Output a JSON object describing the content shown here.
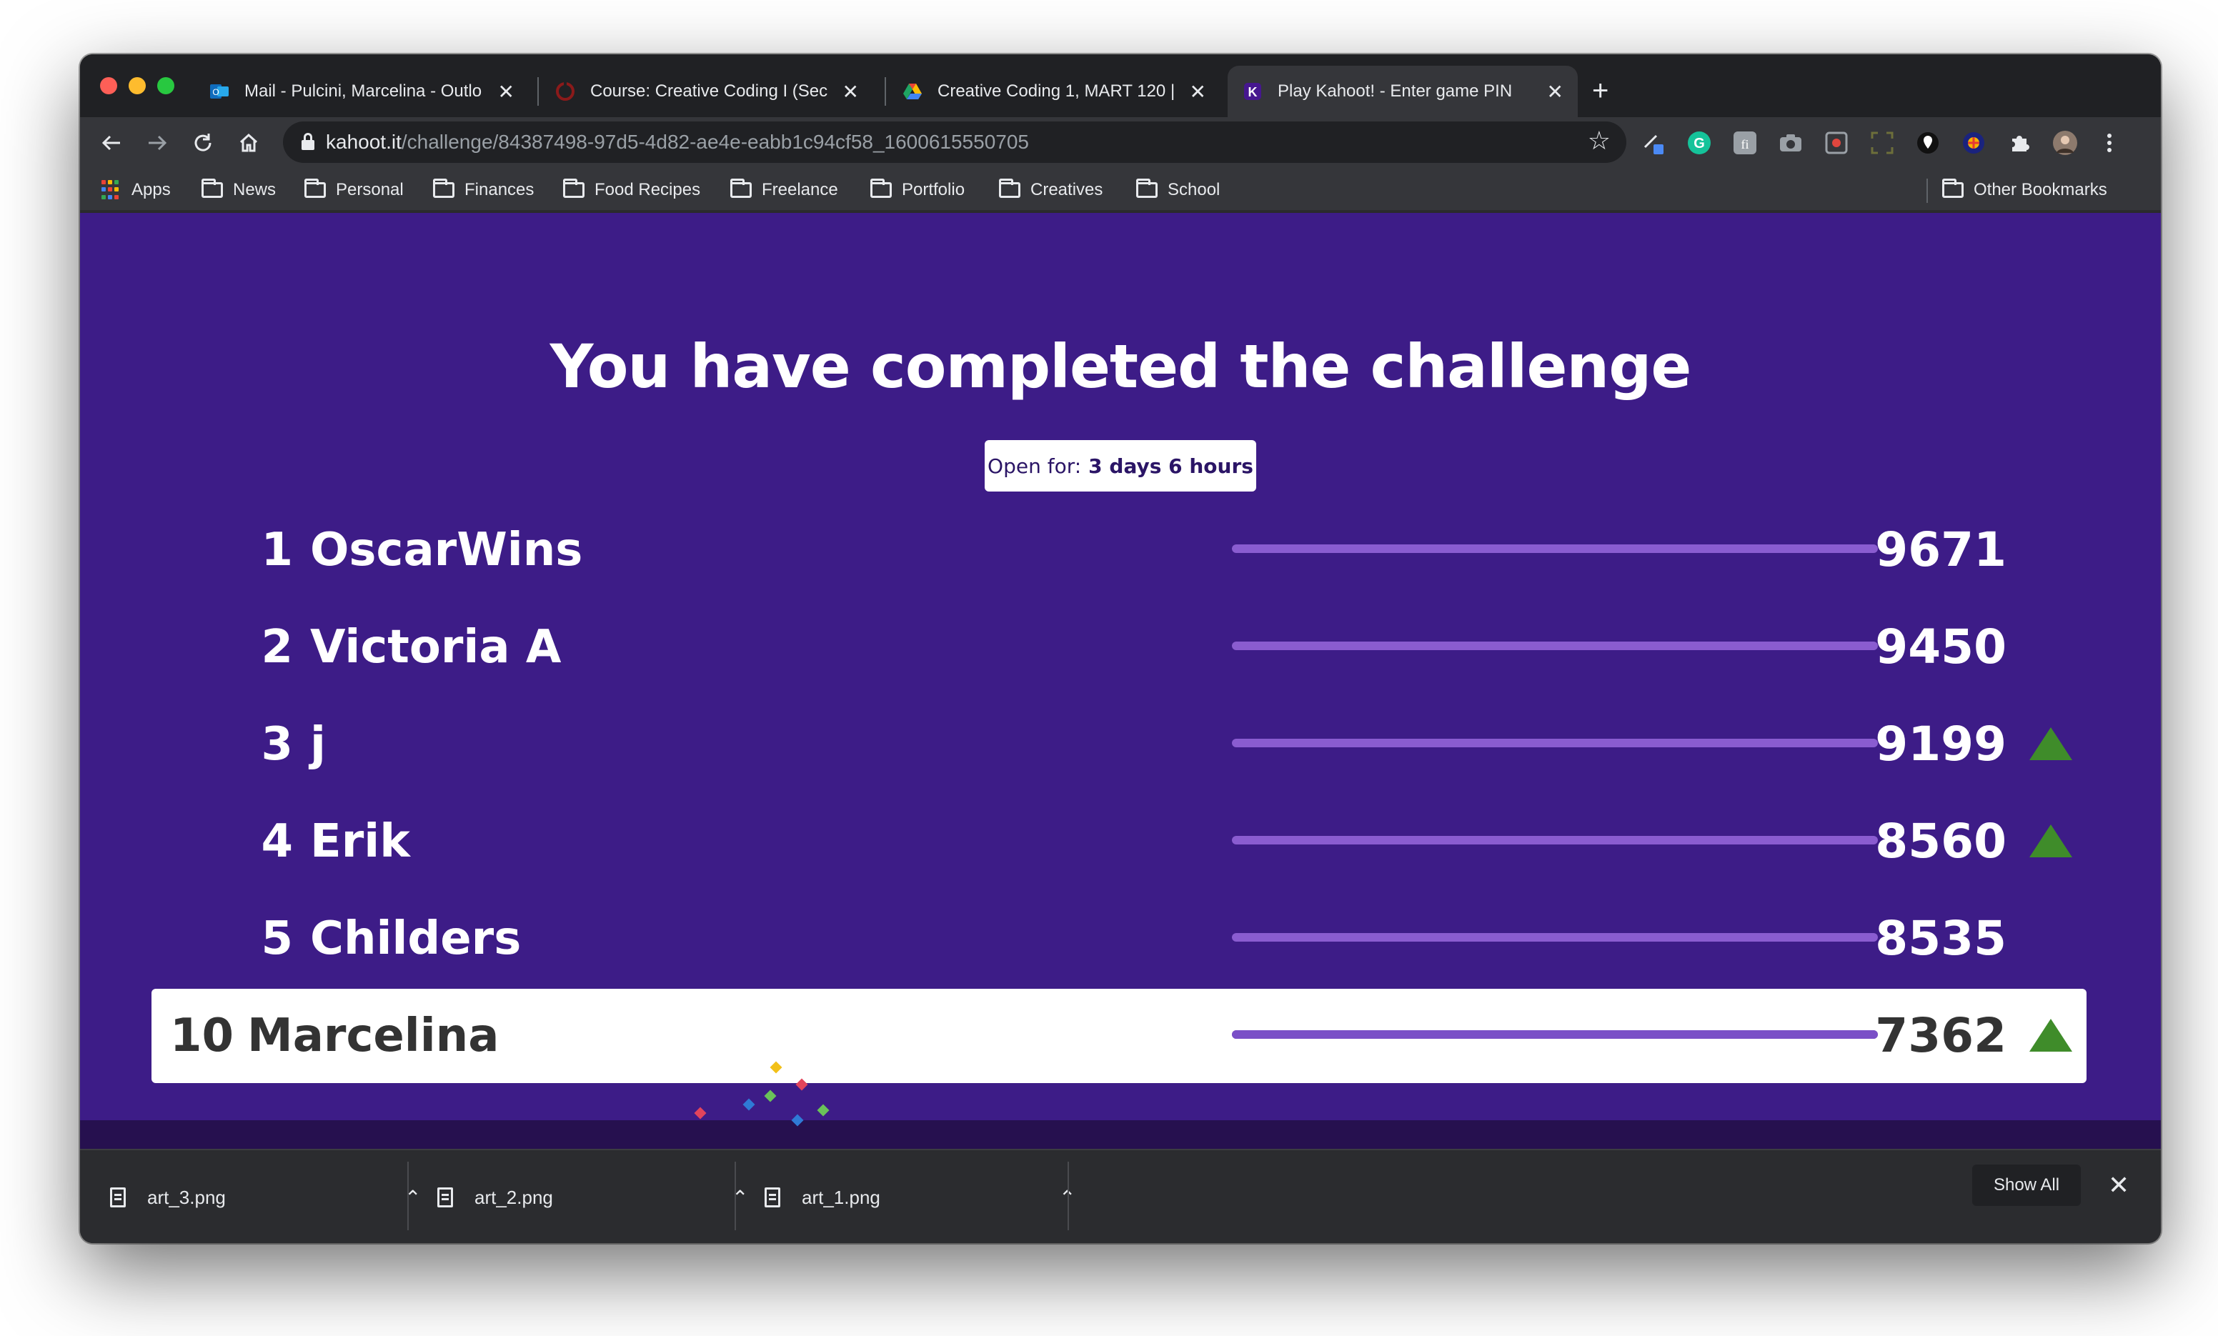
{
  "browser": {
    "tabs": [
      {
        "title": "Mail - Pulcini, Marcelina - Outlo",
        "icon": "outlook-icon",
        "active": false
      },
      {
        "title": "Course: Creative Coding I (Sec",
        "icon": "course-icon",
        "active": false
      },
      {
        "title": "Creative Coding 1, MART 120 |",
        "icon": "drive-icon",
        "active": false
      },
      {
        "title": "Play Kahoot! - Enter game PIN",
        "icon": "kahoot-icon",
        "active": true
      }
    ],
    "tab_close_glyph": "✕",
    "new_tab_glyph": "+",
    "url_host": "kahoot.it",
    "url_path": "/challenge/84387498-97d5-4d82-ae4e-eabb1c94cf58_1600615550705",
    "bookmarks": [
      "Apps",
      "News",
      "Personal",
      "Finances",
      "Food Recipes",
      "Freelance",
      "Portfolio",
      "Creatives",
      "School"
    ],
    "other_bookmarks": "Other Bookmarks"
  },
  "page": {
    "headline": "You have completed the challenge",
    "open_for_label": "Open for:",
    "open_for_value": "3 days 6 hours",
    "leaderboard": [
      {
        "rank": "1",
        "name": "OscarWins",
        "score": "9671",
        "trend_up": false
      },
      {
        "rank": "2",
        "name": "Victoria A",
        "score": "9450",
        "trend_up": false
      },
      {
        "rank": "3",
        "name": "j",
        "score": "9199",
        "trend_up": true
      },
      {
        "rank": "4",
        "name": "Erik",
        "score": "8560",
        "trend_up": true
      },
      {
        "rank": "5",
        "name": "Childers",
        "score": "8535",
        "trend_up": false
      }
    ],
    "me": {
      "rank": "10",
      "name": "Marcelina",
      "score": "7362",
      "trend_up": true
    },
    "bar_fill_fraction": 1.0,
    "colors": {
      "background": "#3d1c87",
      "bar": "#8a5cd0",
      "trend_up": "#3f8c2a"
    }
  },
  "downloads": {
    "files": [
      "art_3.png",
      "art_2.png",
      "art_1.png"
    ],
    "show_all": "Show All",
    "close_glyph": "✕"
  }
}
